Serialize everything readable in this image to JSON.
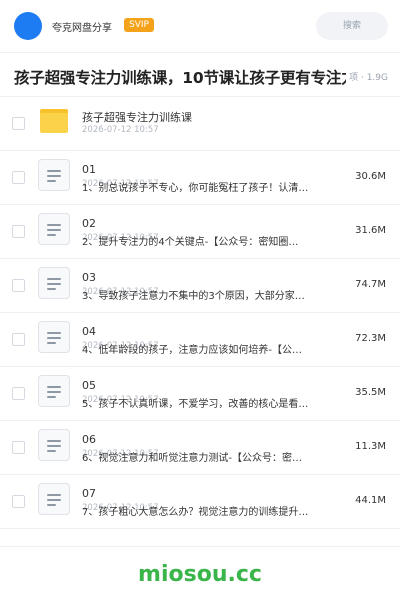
{
  "header": {
    "username": "夸克网盘分享",
    "badge": "SVIP",
    "search_placeholder": "搜索"
  },
  "share": {
    "title": "孩子超强专注力训练课，10节课让孩子更有专注力",
    "meta": "项 · 1.9G"
  },
  "folder": {
    "name": "孩子超强专注力训练课",
    "date": "2026-07-12 10:57"
  },
  "files": [
    {
      "number": "01",
      "date": "2026-07-12 10:57",
      "name": "1、别总说孩子不专心，你可能冤枉了孩子！认清…",
      "size": "30.6M"
    },
    {
      "number": "02",
      "date": "2026-07-12 10:57",
      "name": "2、提升专注力的4个关键点-【公众号：密知圈…",
      "size": "31.6M"
    },
    {
      "number": "03",
      "date": "2026-07-12 10:57",
      "name": "3、导致孩子注意力不集中的3个原因，大部分家…",
      "size": "74.7M"
    },
    {
      "number": "04",
      "date": "2026-07-12 10:57",
      "name": "4、低年龄段的孩子，注意力应该如何培养-【公…",
      "size": "72.3M"
    },
    {
      "number": "05",
      "date": "2026-07-12 10:57",
      "name": "5、孩子不认真听课，不爱学习，改善的核心是看…",
      "size": "35.5M"
    },
    {
      "number": "06",
      "date": "2026-07-12 10:57",
      "name": "6、视觉注意力和听觉注意力测试-【公众号：密…",
      "size": "11.3M"
    },
    {
      "number": "07",
      "date": "2026-07-12 10:57",
      "name": "7、孩子粗心大意怎么办？视觉注意力的训练提升…",
      "size": "44.1M"
    }
  ],
  "footer": {
    "brand": "miosou.cc"
  },
  "colors": {
    "avatar": "#1e7cf2",
    "badge": "#f5a21b",
    "folder": "#fbd34b",
    "brand": "#3ab54a"
  },
  "icons": {
    "folder": "folder-icon",
    "file": "document-icon"
  }
}
